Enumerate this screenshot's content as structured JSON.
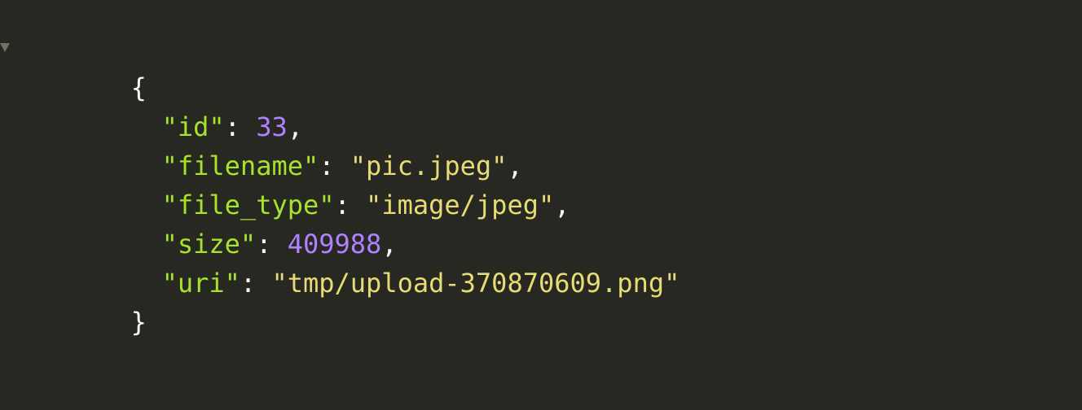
{
  "colors": {
    "background": "#272822",
    "key": "#a6e22e",
    "string": "#e6db74",
    "number": "#ae81ff",
    "punctuation": "#f8f8f2",
    "fold_toggle": "#75715e"
  },
  "icons": {
    "fold_toggle": "triangle-down"
  },
  "json": {
    "open_brace": "{",
    "close_brace": "}",
    "entries": [
      {
        "key": "\"id\"",
        "value": "33",
        "type": "number",
        "comma": ","
      },
      {
        "key": "\"filename\"",
        "value": "\"pic.jpeg\"",
        "type": "string",
        "comma": ","
      },
      {
        "key": "\"file_type\"",
        "value": "\"image/jpeg\"",
        "type": "string",
        "comma": ","
      },
      {
        "key": "\"size\"",
        "value": "409988",
        "type": "number",
        "comma": ","
      },
      {
        "key": "\"uri\"",
        "value": "\"tmp/upload-370870609.png\"",
        "type": "string",
        "comma": ""
      }
    ]
  }
}
